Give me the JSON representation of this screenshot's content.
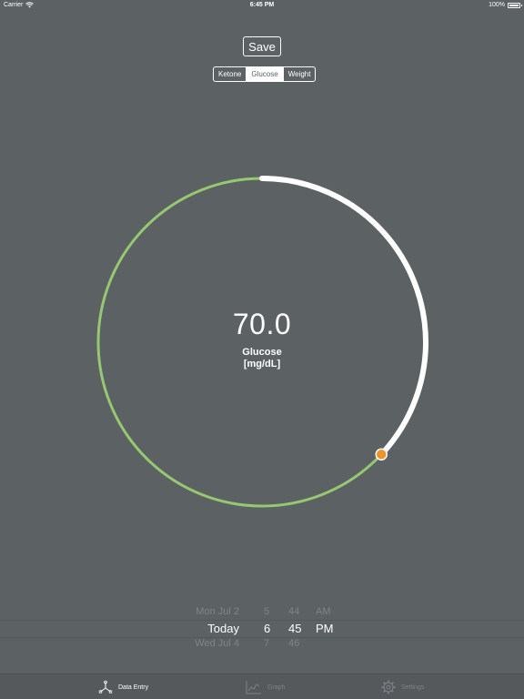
{
  "status_bar": {
    "carrier": "Carrier",
    "time": "6:45 PM",
    "battery": "100%"
  },
  "toolbar": {
    "save_label": "Save"
  },
  "segments": [
    {
      "label": "Ketone",
      "selected": false
    },
    {
      "label": "Glucose",
      "selected": true
    },
    {
      "label": "Weight",
      "selected": false
    }
  ],
  "dial": {
    "value": "70.0",
    "label": "Glucose",
    "unit": "[mg/dL]",
    "progress_fraction": 0.37,
    "colors": {
      "track": "#96c873",
      "progress": "#ffffff",
      "knob": "#f0922a"
    }
  },
  "picker": {
    "date_column": [
      {
        "text": "Mon Jul 2",
        "state": "near"
      },
      {
        "text": "Today",
        "state": "selected"
      },
      {
        "text": "Wed Jul 4",
        "state": "near"
      }
    ],
    "hour_column": [
      {
        "text": "5",
        "state": "near"
      },
      {
        "text": "6",
        "state": "selected"
      },
      {
        "text": "7",
        "state": "near"
      }
    ],
    "minute_column": [
      {
        "text": "44",
        "state": "near"
      },
      {
        "text": "45",
        "state": "selected"
      },
      {
        "text": "46",
        "state": "near"
      }
    ],
    "ampm_column": [
      {
        "text": "AM",
        "state": "near"
      },
      {
        "text": "PM",
        "state": "selected"
      }
    ]
  },
  "tabs": [
    {
      "label": "Data Entry",
      "icon": "data-entry-icon",
      "active": true
    },
    {
      "label": "Graph",
      "icon": "graph-icon",
      "active": false
    },
    {
      "label": "Settings",
      "icon": "gear-icon",
      "active": false
    }
  ],
  "colors": {
    "background": "#5c6164",
    "tab_bar": "#55595c"
  }
}
